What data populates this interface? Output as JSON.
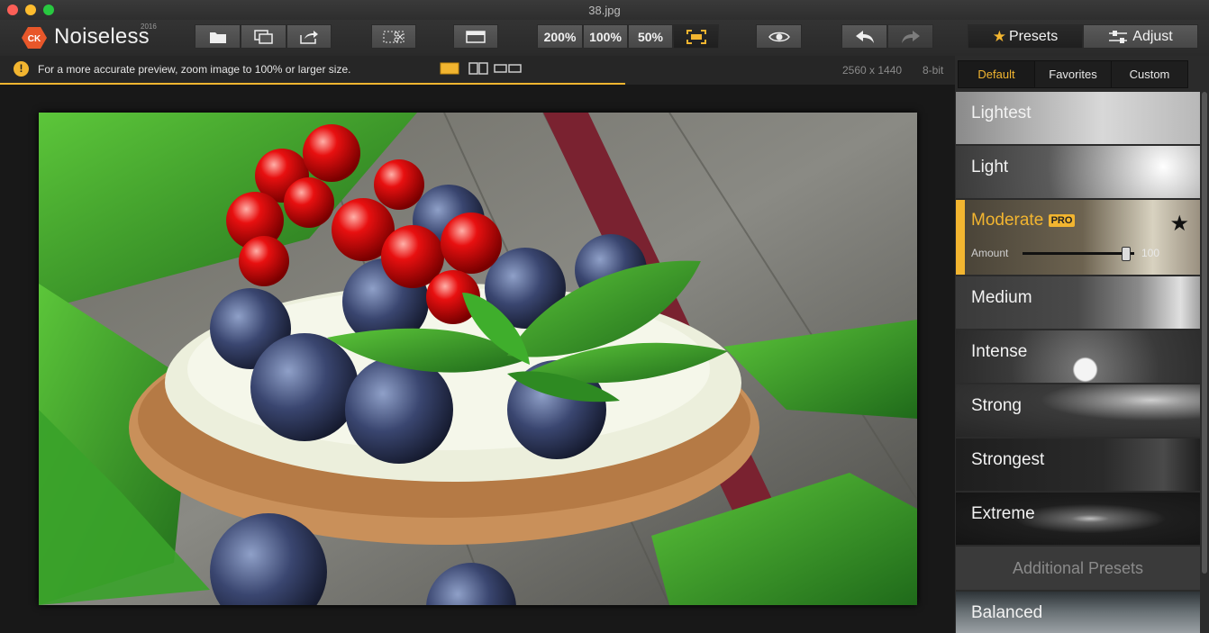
{
  "window": {
    "title": "38.jpg"
  },
  "app": {
    "name": "Noiseless",
    "year": "2016",
    "badge": "CK"
  },
  "toolbar": {
    "zoom_200": "200%",
    "zoom_100": "100%",
    "zoom_50": "50%",
    "presets_label": "Presets",
    "adjust_label": "Adjust"
  },
  "infobar": {
    "message": "For a more accurate preview, zoom image to 100% or larger size.",
    "image_size": "2560 x 1440",
    "bit_depth": "8-bit",
    "progress": 0.655
  },
  "sidebar": {
    "tabs": [
      "Default",
      "Favorites",
      "Custom"
    ],
    "presets": [
      {
        "name": "Lightest"
      },
      {
        "name": "Light"
      },
      {
        "name": "Moderate",
        "badge": "PRO",
        "amount_label": "Amount",
        "amount_value": "100",
        "amount_fraction": 0.9,
        "active": true
      },
      {
        "name": "Medium"
      },
      {
        "name": "Intense"
      },
      {
        "name": "Strong"
      },
      {
        "name": "Strongest"
      },
      {
        "name": "Extreme"
      }
    ],
    "additional_header": "Additional Presets",
    "additional_presets": [
      {
        "name": "Balanced"
      }
    ]
  },
  "colors": {
    "accent": "#f2b530",
    "bg": "#1c1c1c",
    "sidebar": "#2b2b2b"
  }
}
